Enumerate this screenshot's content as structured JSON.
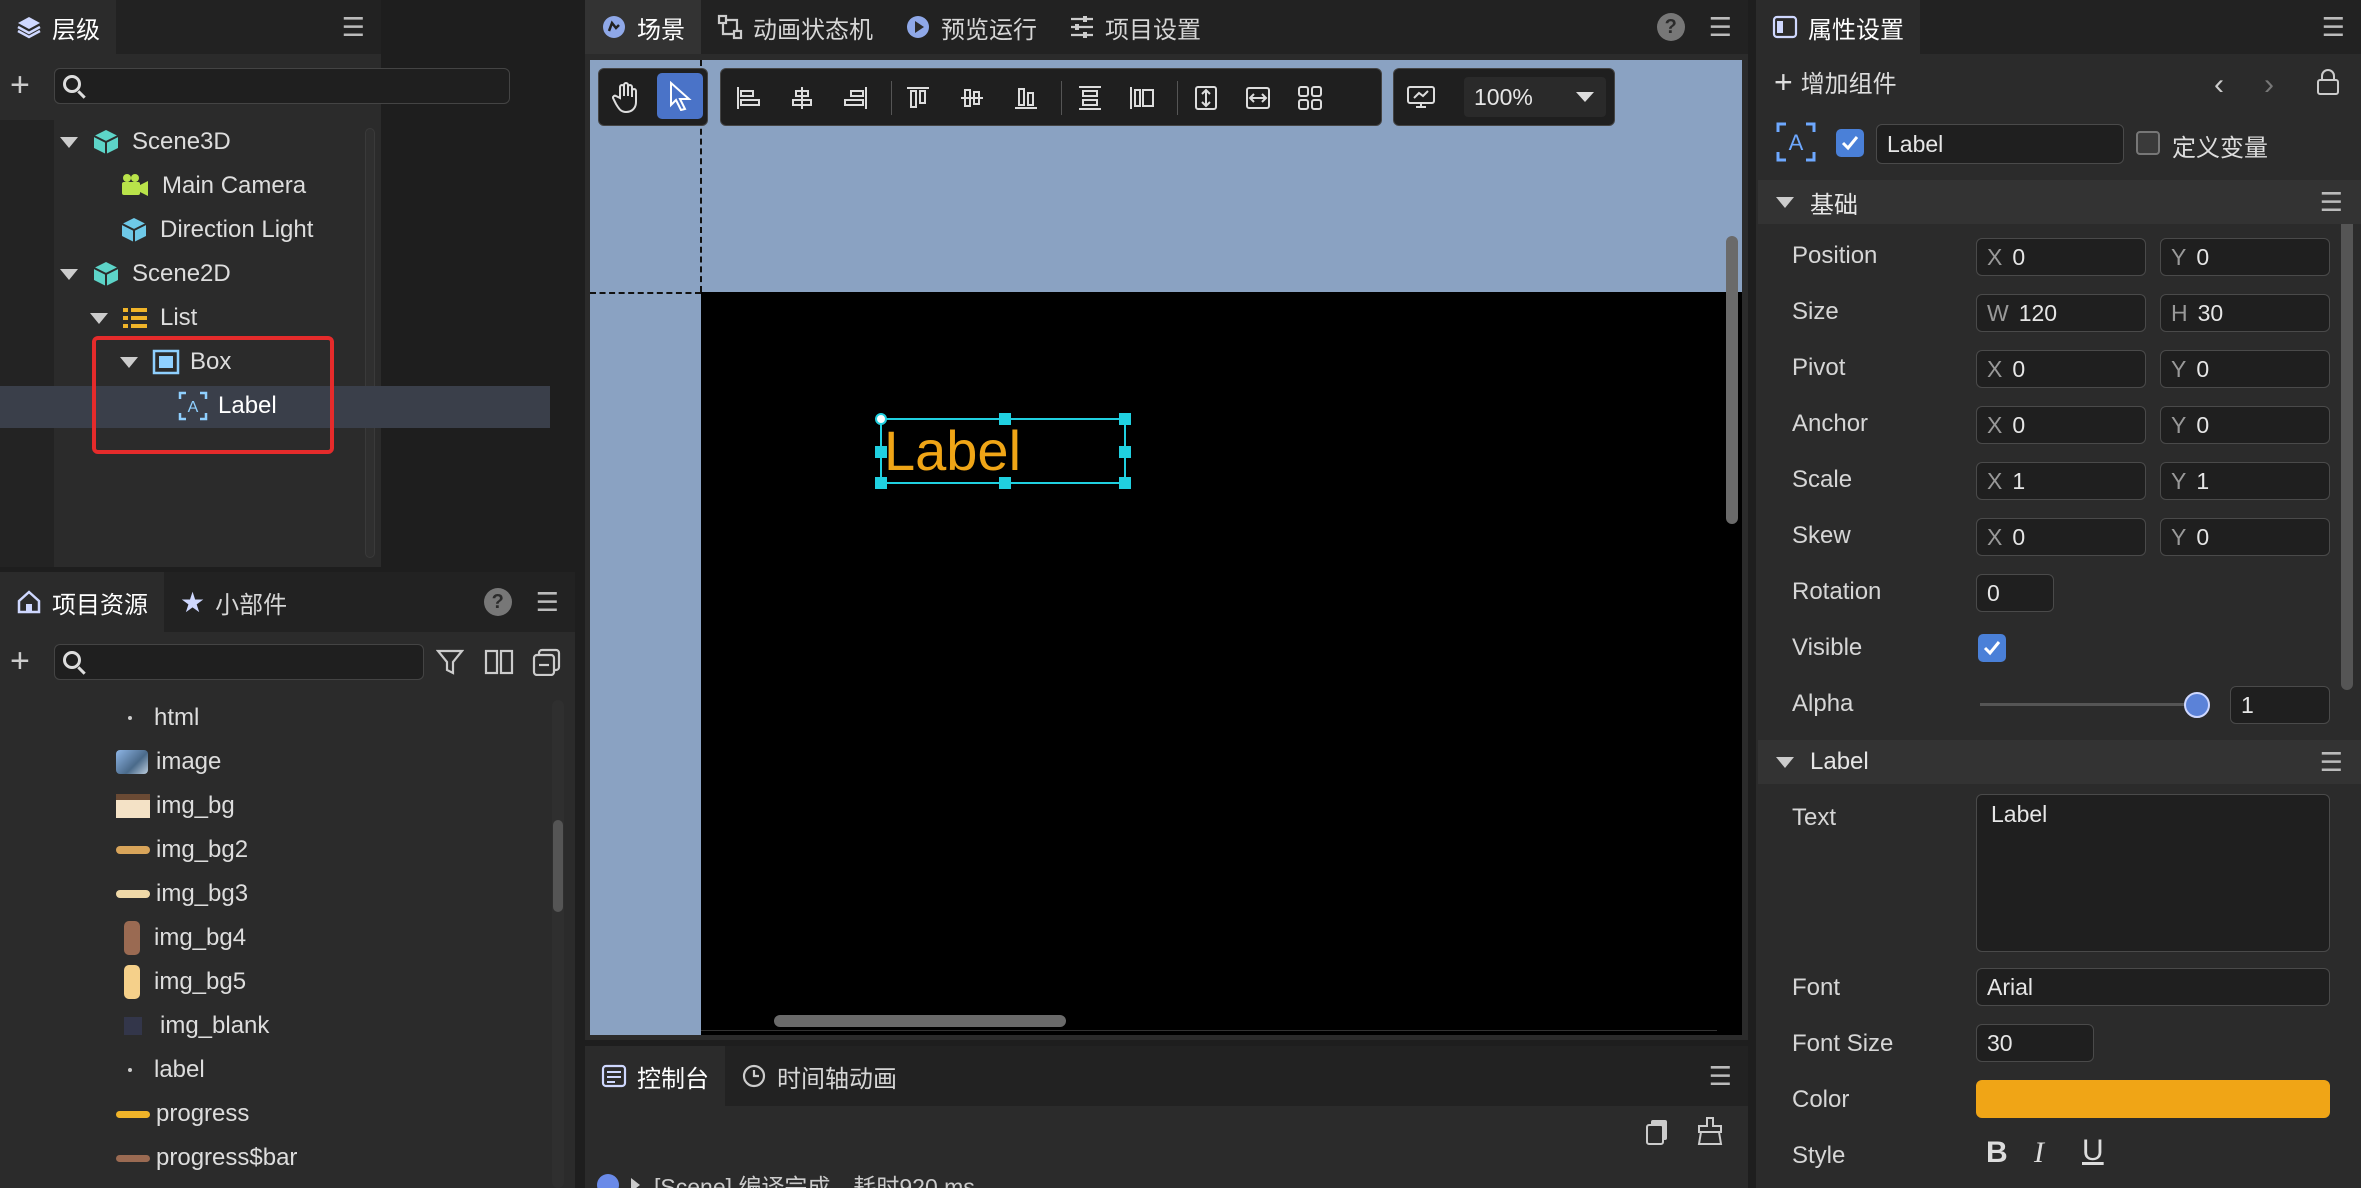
{
  "hierarchy": {
    "title": "层级",
    "nodes": [
      "Scene3D",
      "Main Camera",
      "Direction Light",
      "Scene2D",
      "List",
      "Box",
      "Label"
    ]
  },
  "assets": {
    "tab_assets": "项目资源",
    "tab_widgets": "小部件",
    "items": [
      "html",
      "image",
      "img_bg",
      "img_bg2",
      "img_bg3",
      "img_bg4",
      "img_bg5",
      "img_blank",
      "label",
      "progress",
      "progress$bar"
    ]
  },
  "center": {
    "tabs": [
      "场景",
      "动画状态机",
      "预览运行",
      "项目设置"
    ],
    "zoom": "100%",
    "canvas_label": "Label"
  },
  "console": {
    "tabs": [
      "控制台",
      "时间轴动画"
    ],
    "log": "[Scene] 编译完成，耗时920 ms"
  },
  "inspector": {
    "title": "属性设置",
    "add_component": "增加组件",
    "name": "Label",
    "define_var": "定义变量",
    "section_basic": "基础",
    "rows": [
      {
        "label": "Position",
        "a": "X",
        "av": "0",
        "b": "Y",
        "bv": "0"
      },
      {
        "label": "Size",
        "a": "W",
        "av": "120",
        "b": "H",
        "bv": "30"
      },
      {
        "label": "Pivot",
        "a": "X",
        "av": "0",
        "b": "Y",
        "bv": "0"
      },
      {
        "label": "Anchor",
        "a": "X",
        "av": "0",
        "b": "Y",
        "bv": "0"
      },
      {
        "label": "Scale",
        "a": "X",
        "av": "1",
        "b": "Y",
        "bv": "1"
      },
      {
        "label": "Skew",
        "a": "X",
        "av": "0",
        "b": "Y",
        "bv": "0"
      }
    ],
    "rotation_label": "Rotation",
    "rotation": "0",
    "visible_label": "Visible",
    "alpha_label": "Alpha",
    "alpha": "1",
    "section_label": "Label",
    "text_label": "Text",
    "text": "Label",
    "font_label": "Font",
    "font": "Arial",
    "fontsize_label": "Font Size",
    "fontsize": "30",
    "color_label": "Color",
    "color": "#f0a516",
    "style_label": "Style"
  }
}
